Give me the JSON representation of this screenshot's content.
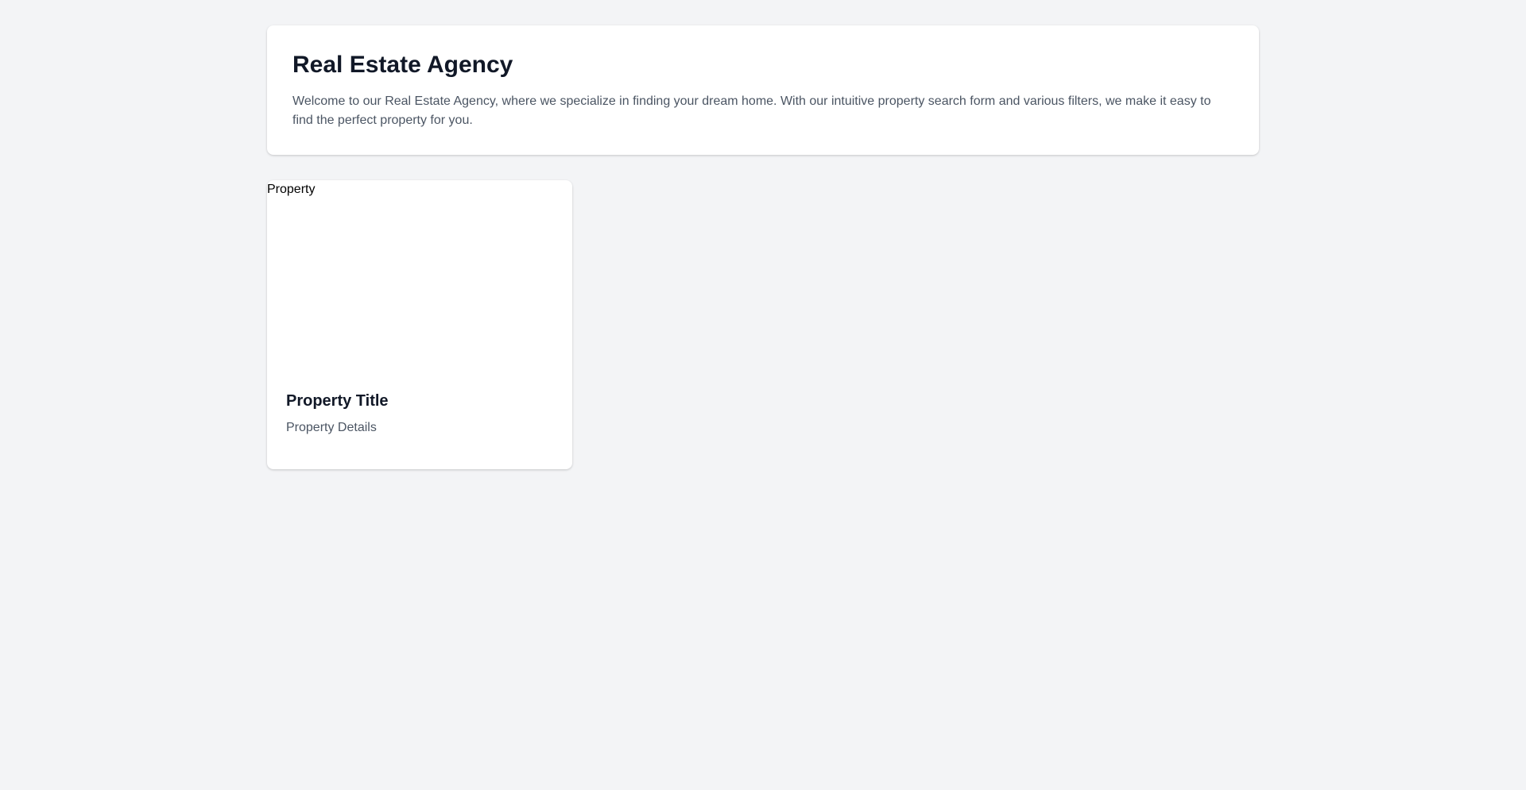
{
  "header": {
    "title": "Real Estate Agency",
    "intro": "Welcome to our Real Estate Agency, where we specialize in finding your dream home. With our intuitive property search form and various filters, we make it easy to find the perfect property for you."
  },
  "listings": [
    {
      "image_alt": "Property",
      "title": "Property Title",
      "details": "Property Details"
    }
  ],
  "colors": {
    "background": "#f3f4f6",
    "card": "#ffffff",
    "heading": "#111827",
    "body_text": "#4b5563"
  }
}
